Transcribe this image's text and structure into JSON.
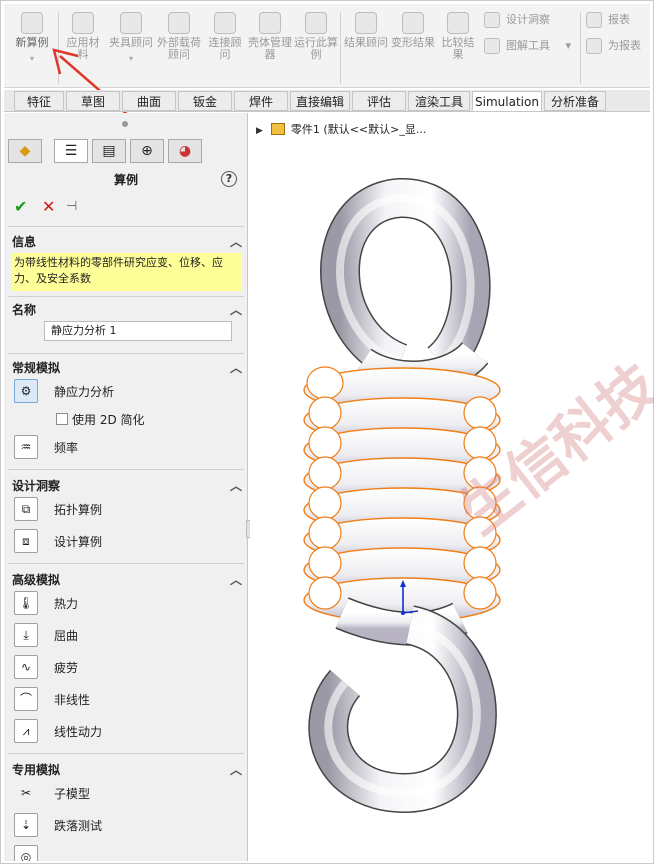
{
  "ribbon": {
    "buttons": [
      {
        "label": "新算例"
      },
      {
        "label": "应用材料"
      },
      {
        "label": "夹具顾问"
      },
      {
        "label": "外部载荷顾问"
      },
      {
        "label": "连接顾问"
      },
      {
        "label": "壳体管理器"
      },
      {
        "label": "运行此算例"
      },
      {
        "label": "结果顾问"
      },
      {
        "label": "变形结果"
      },
      {
        "label": "比较结果"
      }
    ],
    "small": [
      {
        "label": "设计洞察"
      },
      {
        "label": "图解工具"
      },
      {
        "label": "报表"
      },
      {
        "label": "为报表"
      }
    ]
  },
  "tabs": [
    "特征",
    "草图",
    "曲面",
    "钣金",
    "焊件",
    "直接编辑",
    "评估",
    "渲染工具",
    "Simulation",
    "分析准备"
  ],
  "active_tab": "Simulation",
  "panel": {
    "title": "算例",
    "help": "?",
    "ok": "✔",
    "cancel": "✕",
    "pin": "⊣",
    "info": {
      "header": "信息",
      "text": "为带线性材料的零部件研究应变、位移、应力、及安全系数"
    },
    "name": {
      "header": "名称",
      "value": "静应力分析 1"
    },
    "general": {
      "header": "常规模拟",
      "items": [
        "静应力分析",
        "频率"
      ],
      "checkbox": "使用 2D 简化"
    },
    "design": {
      "header": "设计洞察",
      "items": [
        "拓扑算例",
        "设计算例"
      ]
    },
    "advanced": {
      "header": "高级模拟",
      "items": [
        "热力",
        "屈曲",
        "疲劳",
        "非线性",
        "线性动力"
      ]
    },
    "special": {
      "header": "专用模拟",
      "items": [
        "子模型",
        "跌落测试"
      ]
    }
  },
  "tree": {
    "label": "零件1 (默认<<默认>_显..."
  },
  "watermark": "生信科技",
  "colors": {
    "accent_arrow": "#e0352b",
    "selection_edges": "#f07d16",
    "info_bg": "#ffff99"
  }
}
